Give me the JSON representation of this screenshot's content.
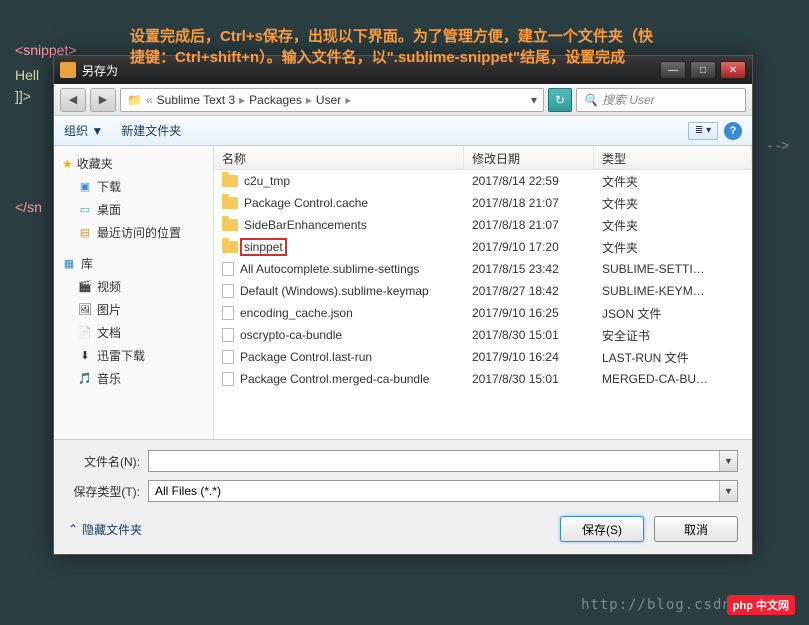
{
  "code": {
    "line1_open": "<",
    "line1_tag": "snippet",
    "line1_close": ">",
    "line2_txt": "Hell",
    "line3_txt": "]]>",
    "line4_open": "</",
    "line4_tag": "sn",
    "bg_dashes": "- ->"
  },
  "annotation": {
    "line1": "设置完成后，Ctrl+s保存，出现以下界面。为了管理方便，建立一个文件夹（快",
    "line2": "捷键：Ctrl+shift+n）。输入文件名，以\".sublime-snippet\"结尾，设置完成"
  },
  "dialog": {
    "title": "另存为",
    "breadcrumb": {
      "seg1": "Sublime Text 3",
      "seg2": "Packages",
      "seg3": "User"
    },
    "search_placeholder": "搜索 User",
    "toolbar": {
      "organize": "组织 ▼",
      "new_folder": "新建文件夹"
    },
    "sidebar": {
      "fav": "收藏夹",
      "fav_items": [
        "下载",
        "桌面",
        "最近访问的位置"
      ],
      "lib": "库",
      "lib_items": [
        "视频",
        "图片",
        "文档",
        "迅雷下载",
        "音乐"
      ]
    },
    "columns": {
      "name": "名称",
      "date": "修改日期",
      "type": "类型"
    },
    "rows": [
      {
        "icon": "folder",
        "name": "c2u_tmp",
        "date": "2017/8/14 22:59",
        "type": "文件夹",
        "hl": false
      },
      {
        "icon": "folder",
        "name": "Package Control.cache",
        "date": "2017/8/18 21:07",
        "type": "文件夹",
        "hl": false
      },
      {
        "icon": "folder",
        "name": "SideBarEnhancements",
        "date": "2017/8/18 21:07",
        "type": "文件夹",
        "hl": false
      },
      {
        "icon": "folder",
        "name": "sinppet",
        "date": "2017/9/10 17:20",
        "type": "文件夹",
        "hl": true
      },
      {
        "icon": "file",
        "name": "All Autocomplete.sublime-settings",
        "date": "2017/8/15 23:42",
        "type": "SUBLIME-SETTI…",
        "hl": false
      },
      {
        "icon": "file",
        "name": "Default (Windows).sublime-keymap",
        "date": "2017/8/27 18:42",
        "type": "SUBLIME-KEYM…",
        "hl": false
      },
      {
        "icon": "file",
        "name": "encoding_cache.json",
        "date": "2017/9/10 16:25",
        "type": "JSON 文件",
        "hl": false
      },
      {
        "icon": "file",
        "name": "oscrypto-ca-bundle",
        "date": "2017/8/30 15:01",
        "type": "安全证书",
        "hl": false
      },
      {
        "icon": "file",
        "name": "Package Control.last-run",
        "date": "2017/9/10 16:24",
        "type": "LAST-RUN 文件",
        "hl": false
      },
      {
        "icon": "file",
        "name": "Package Control.merged-ca-bundle",
        "date": "2017/8/30 15:01",
        "type": "MERGED-CA-BU…",
        "hl": false
      }
    ],
    "filename_label": "文件名(N):",
    "filename_value": "",
    "filetype_label": "保存类型(T):",
    "filetype_value": "All Files (*.*)",
    "hide_folders": "隐藏文件夹",
    "save_btn": "保存(S)",
    "cancel_btn": "取消"
  },
  "watermark": "http://blog.csdn.net/",
  "phpcn": "php 中文网"
}
